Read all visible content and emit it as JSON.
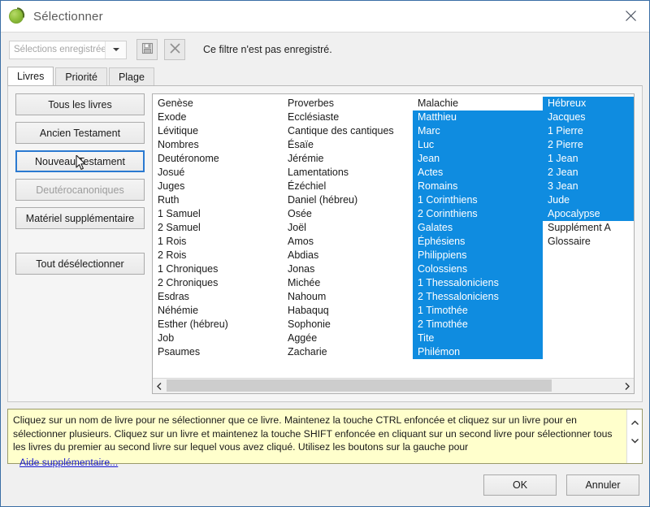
{
  "window": {
    "title": "Sélectionner",
    "logo_icon": "olive-leaf-icon",
    "close_icon": "close-icon"
  },
  "toolbar": {
    "saved_selections_value": "Sélections enregistrées",
    "saved_selections_placeholder": "Sélections enregistrées",
    "dropdown_icon": "chevron-down-icon",
    "save_icon": "save-floppy-icon",
    "delete_icon": "delete-x-icon",
    "filter_status": "Ce filtre n'est pas enregistré."
  },
  "tabs": [
    {
      "label": "Livres",
      "active": true
    },
    {
      "label": "Priorité",
      "active": false
    },
    {
      "label": "Plage",
      "active": false
    }
  ],
  "buttons": {
    "all_books": "Tous les livres",
    "old_testament": "Ancien Testament",
    "new_testament": "Nouveau Testament",
    "deuterocanonical": "Deutérocanoniques",
    "supplementary": "Matériel supplémentaire",
    "deselect_all": "Tout désélectionner"
  },
  "colors": {
    "selection_blue": "#0f8ce0",
    "focus_blue": "#2b7ad1",
    "help_yellow": "#ffffcc",
    "link_blue": "#1a1acc"
  },
  "book_list": {
    "columns": [
      {
        "items": [
          {
            "label": "Genèse",
            "selected": false
          },
          {
            "label": "Exode",
            "selected": false
          },
          {
            "label": "Lévitique",
            "selected": false
          },
          {
            "label": "Nombres",
            "selected": false
          },
          {
            "label": "Deutéronome",
            "selected": false
          },
          {
            "label": "Josué",
            "selected": false
          },
          {
            "label": "Juges",
            "selected": false
          },
          {
            "label": "Ruth",
            "selected": false
          },
          {
            "label": "1 Samuel",
            "selected": false
          },
          {
            "label": "2 Samuel",
            "selected": false
          },
          {
            "label": "1 Rois",
            "selected": false
          },
          {
            "label": "2 Rois",
            "selected": false
          },
          {
            "label": "1 Chroniques",
            "selected": false
          },
          {
            "label": "2 Chroniques",
            "selected": false
          },
          {
            "label": "Esdras",
            "selected": false
          },
          {
            "label": "Néhémie",
            "selected": false
          },
          {
            "label": "Esther (hébreu)",
            "selected": false
          },
          {
            "label": "Job",
            "selected": false
          },
          {
            "label": "Psaumes",
            "selected": false
          }
        ]
      },
      {
        "items": [
          {
            "label": "Proverbes",
            "selected": false
          },
          {
            "label": "Ecclésiaste",
            "selected": false
          },
          {
            "label": "Cantique des cantiques",
            "selected": false
          },
          {
            "label": "Ésaïe",
            "selected": false
          },
          {
            "label": "Jérémie",
            "selected": false
          },
          {
            "label": "Lamentations",
            "selected": false
          },
          {
            "label": "Ézéchiel",
            "selected": false
          },
          {
            "label": "Daniel (hébreu)",
            "selected": false
          },
          {
            "label": "Osée",
            "selected": false
          },
          {
            "label": "Joël",
            "selected": false
          },
          {
            "label": "Amos",
            "selected": false
          },
          {
            "label": "Abdias",
            "selected": false
          },
          {
            "label": "Jonas",
            "selected": false
          },
          {
            "label": "Michée",
            "selected": false
          },
          {
            "label": "Nahoum",
            "selected": false
          },
          {
            "label": "Habaquq",
            "selected": false
          },
          {
            "label": "Sophonie",
            "selected": false
          },
          {
            "label": "Aggée",
            "selected": false
          },
          {
            "label": "Zacharie",
            "selected": false
          }
        ]
      },
      {
        "items": [
          {
            "label": "Malachie",
            "selected": false
          },
          {
            "label": "Matthieu",
            "selected": true
          },
          {
            "label": "Marc",
            "selected": true
          },
          {
            "label": "Luc",
            "selected": true
          },
          {
            "label": "Jean",
            "selected": true
          },
          {
            "label": "Actes",
            "selected": true
          },
          {
            "label": "Romains",
            "selected": true
          },
          {
            "label": "1 Corinthiens",
            "selected": true
          },
          {
            "label": "2 Corinthiens",
            "selected": true
          },
          {
            "label": "Galates",
            "selected": true
          },
          {
            "label": "Éphésiens",
            "selected": true
          },
          {
            "label": "Philippiens",
            "selected": true
          },
          {
            "label": "Colossiens",
            "selected": true
          },
          {
            "label": "1 Thessaloniciens",
            "selected": true
          },
          {
            "label": "2 Thessaloniciens",
            "selected": true
          },
          {
            "label": "1 Timothée",
            "selected": true
          },
          {
            "label": "2 Timothée",
            "selected": true
          },
          {
            "label": "Tite",
            "selected": true
          },
          {
            "label": "Philémon",
            "selected": true
          }
        ]
      },
      {
        "items": [
          {
            "label": "Hébreux",
            "selected": true
          },
          {
            "label": "Jacques",
            "selected": true
          },
          {
            "label": "1 Pierre",
            "selected": true
          },
          {
            "label": "2 Pierre",
            "selected": true
          },
          {
            "label": "1 Jean",
            "selected": true
          },
          {
            "label": "2 Jean",
            "selected": true
          },
          {
            "label": "3 Jean",
            "selected": true
          },
          {
            "label": "Jude",
            "selected": true
          },
          {
            "label": "Apocalypse",
            "selected": true
          },
          {
            "label": "Supplément A",
            "selected": false
          },
          {
            "label": "Glossaire",
            "selected": false
          }
        ]
      }
    ]
  },
  "help": {
    "text": "Cliquez sur un nom de livre pour ne sélectionner que ce livre. Maintenez la touche CTRL enfoncée et cliquez sur un livre pour en sélectionner plusieurs. Cliquez sur un livre et maintenez la touche SHIFT enfoncée en cliquant sur un second livre pour sélectionner tous les livres du premier au second livre sur lequel vous avez cliqué. Utilisez les boutons sur la gauche pour",
    "link": "Aide supplémentaire...",
    "scroll_up_icon": "chevron-up-icon",
    "scroll_down_icon": "chevron-down-icon"
  },
  "footer": {
    "ok": "OK",
    "cancel": "Annuler"
  }
}
